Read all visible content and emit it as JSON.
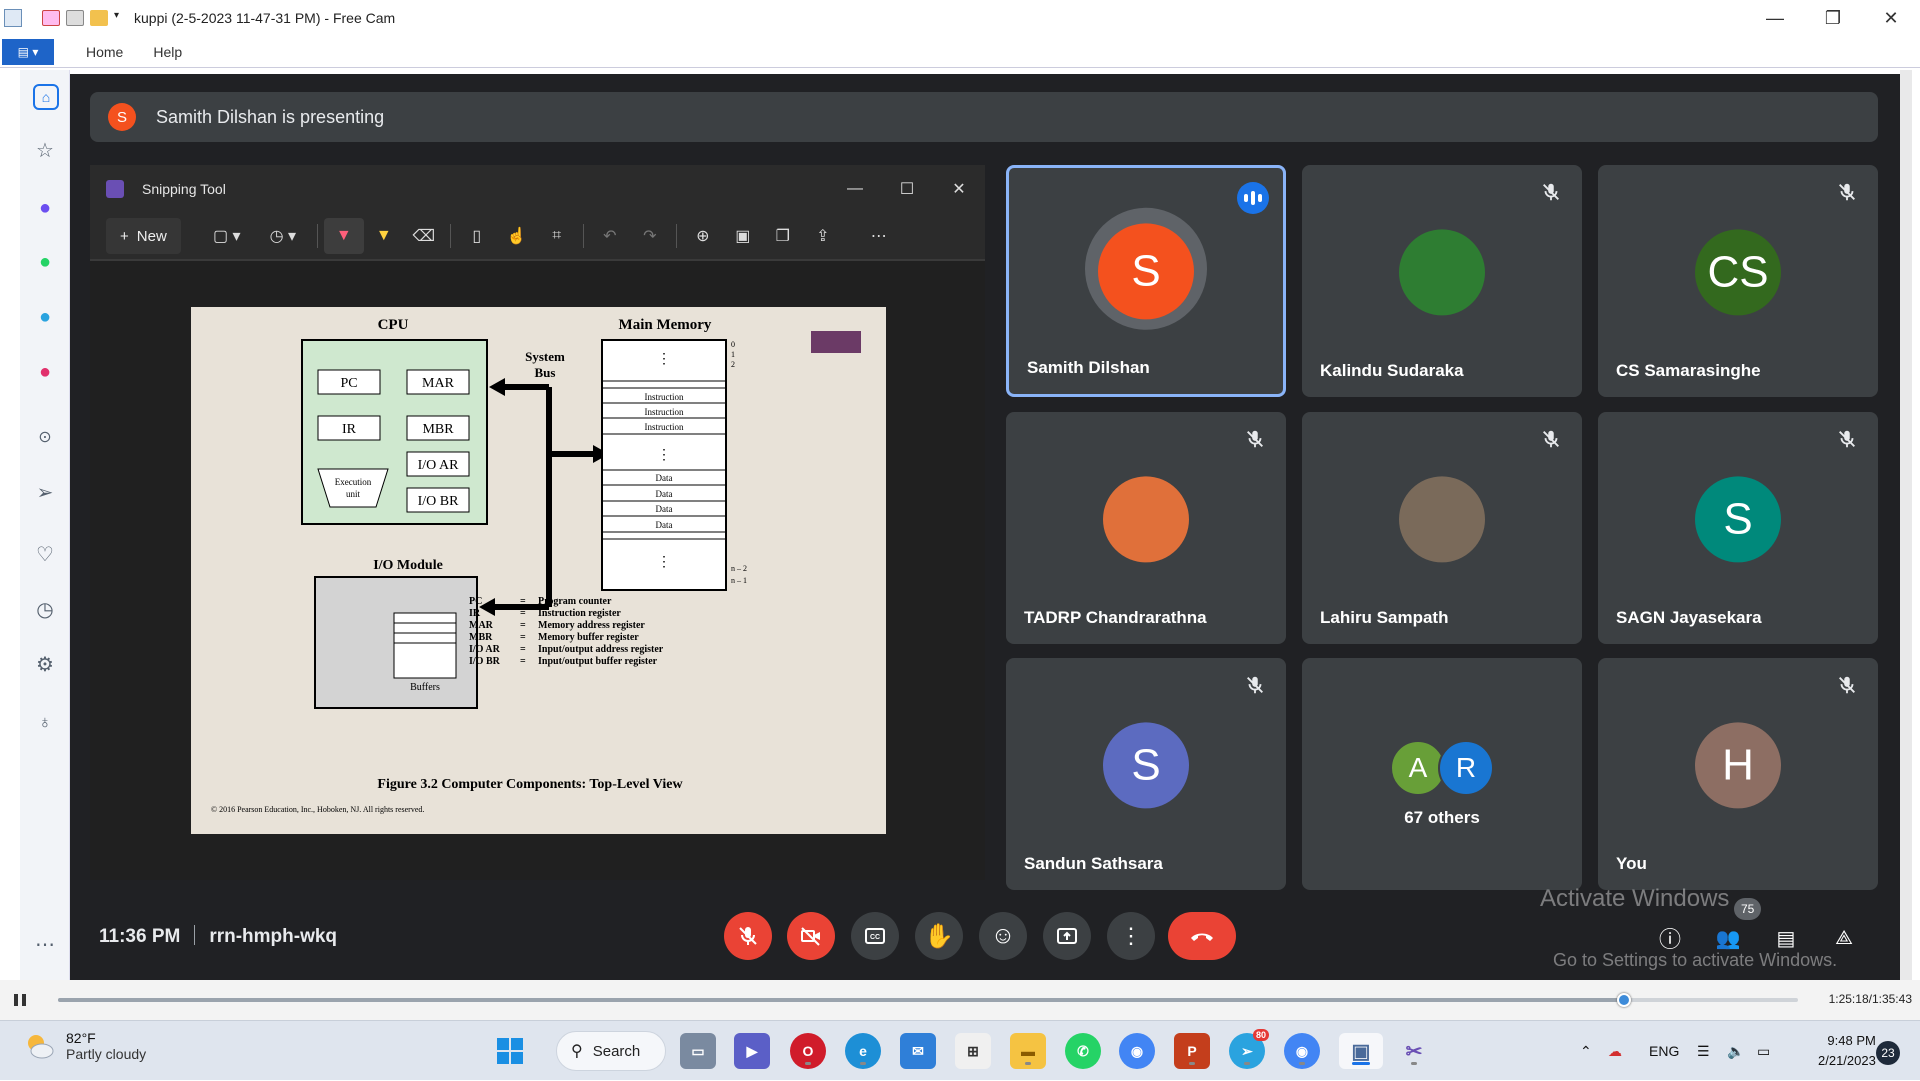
{
  "window": {
    "title": "kuppi (2-5-2023 11-47-31 PM) - Free Cam",
    "menu": [
      "Home",
      "Help"
    ]
  },
  "meet": {
    "presenting_initial": "S",
    "presenting_text": "Samith Dilshan is presenting",
    "time": "11:36 PM",
    "meeting_code": "rrn-hmph-wkq",
    "participant_count": "75",
    "participants": [
      {
        "name": "Samith Dilshan",
        "initial": "S",
        "color": "#f4511e",
        "speaking": true
      },
      {
        "name": "Kalindu Sudaraka",
        "initial": "",
        "color": "#2e7d32"
      },
      {
        "name": "CS Samarasinghe",
        "initial": "CS",
        "color": "#33691e"
      },
      {
        "name": "TADRP Chandrarathna",
        "initial": "",
        "color": "#e0703a"
      },
      {
        "name": "Lahiru Sampath",
        "initial": "",
        "color": "#7a6a5a"
      },
      {
        "name": "SAGN Jayasekara",
        "initial": "S",
        "color": "#00897b"
      },
      {
        "name": "Sandun Sathsara",
        "initial": "S",
        "color": "#5c6bc0"
      },
      {
        "name": "You",
        "initial": "H",
        "color": "#8d6e63"
      }
    ],
    "others": {
      "label": "67 others",
      "a": "A",
      "r": "R",
      "a_color": "#689f38",
      "r_color": "#1976d2"
    },
    "watermark_line1": "Activate Windows",
    "watermark_line2": "Go to Settings to activate Windows."
  },
  "snip": {
    "title": "Snipping Tool",
    "new_label": "New"
  },
  "slide": {
    "cpu": "CPU",
    "main_memory": "Main Memory",
    "system_bus": "System",
    "system_bus2": "Bus",
    "pc": "PC",
    "mar": "MAR",
    "ir": "IR",
    "mbr": "MBR",
    "ioar": "I/O AR",
    "iobr": "I/O BR",
    "exec1": "Execution",
    "exec2": "unit",
    "io_module": "I/O Module",
    "buffers": "Buffers",
    "instruction": "Instruction",
    "data": "Data",
    "addr_0": "0",
    "addr_1": "1",
    "addr_2": "2",
    "addr_n2": "n – 2",
    "addr_n1": "n – 1",
    "legend": [
      [
        "PC",
        "=",
        "Program counter"
      ],
      [
        "IR",
        "=",
        "Instruction register"
      ],
      [
        "MAR",
        "=",
        "Memory address register"
      ],
      [
        "MBR",
        "=",
        "Memory buffer register"
      ],
      [
        "I/O AR",
        "=",
        "Input/output address register"
      ],
      [
        "I/O BR",
        "=",
        "Input/output buffer register"
      ]
    ],
    "caption": "Figure 3.2  Computer Components: Top-Level View",
    "copyright": "© 2016 Pearson Education, Inc., Hoboken, NJ. All rights reserved."
  },
  "player": {
    "time": "1:25:18/1:35:43",
    "progress": 0.9
  },
  "taskbar": {
    "temp": "82°F",
    "weather": "Partly cloudy",
    "search": "Search",
    "lang": "ENG",
    "time": "9:48 PM",
    "date": "2/21/2023",
    "notifications": "23",
    "telegram_badge": "80"
  }
}
